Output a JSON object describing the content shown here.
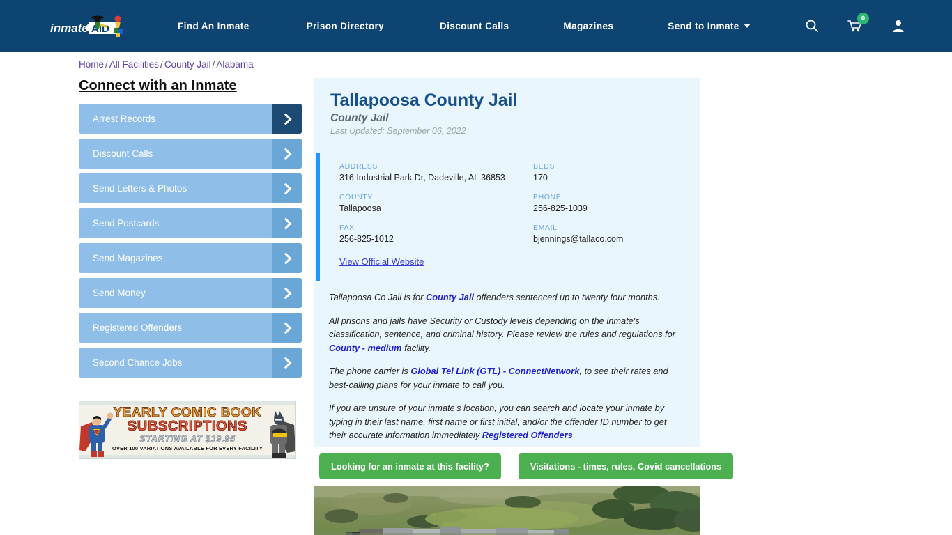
{
  "header": {
    "logo_text": "inmateAID",
    "logo_icon": "inmate-aid-logo",
    "nav_items": [
      {
        "label": "Find An Inmate"
      },
      {
        "label": "Prison Directory"
      },
      {
        "label": "Discount Calls"
      },
      {
        "label": "Magazines"
      },
      {
        "label": "Send to Inmate"
      }
    ],
    "icons": {
      "search": "search-icon",
      "cart": "cart-icon",
      "cart_badge_count": "0",
      "account": "user-account-icon"
    },
    "colors": {
      "nav_bg": "#0e4472",
      "badge": "#2bb673"
    }
  },
  "breadcrumb": {
    "items": [
      {
        "label": "Home"
      },
      {
        "label": "All Facilities"
      },
      {
        "label": "County Jail"
      },
      {
        "label": "Alabama"
      }
    ],
    "separator": "/"
  },
  "sidebar": {
    "title": "Connect with an Inmate",
    "items": [
      {
        "label": "Arrest Records",
        "active": true
      },
      {
        "label": "Discount Calls",
        "active": false
      },
      {
        "label": "Send Letters & Photos",
        "active": false
      },
      {
        "label": "Send Postcards",
        "active": false
      },
      {
        "label": "Send Magazines",
        "active": false
      },
      {
        "label": "Send Money",
        "active": false
      },
      {
        "label": "Registered Offenders",
        "active": false
      },
      {
        "label": "Second Chance Jobs",
        "active": false
      }
    ],
    "ad": {
      "line1": "YEARLY COMIC BOOK",
      "line2": "SUBSCRIPTIONS",
      "line3": "STARTING AT $19.95",
      "line4": "OVER 100 VARIATIONS AVAILABLE FOR EVERY FACILITY"
    }
  },
  "facility": {
    "name": "Tallapoosa County Jail",
    "type": "County Jail",
    "last_updated": "Last Updated: September 06, 2022",
    "details": {
      "address_label": "ADDRESS",
      "address_value": "316 Industrial Park Dr, Dadeville, AL 36853",
      "beds_label": "BEDS",
      "beds_value": "170",
      "county_label": "COUNTY",
      "county_value": "Tallapoosa",
      "phone_label": "PHONE",
      "phone_value": "256-825-1039",
      "fax_label": "FAX",
      "fax_value": "256-825-1012",
      "email_label": "EMAIL",
      "email_value": "bjennings@tallaco.com"
    },
    "official_website_label": "View Official Website"
  },
  "description": {
    "p1_a": "Tallapoosa Co Jail is for ",
    "p1_link": "County Jail",
    "p1_b": " offenders sentenced up to twenty four months.",
    "p2_a": "All prisons and jails have Security or Custody levels depending on the inmate's classification, sentence, and criminal history. Please review the rules and regulations for ",
    "p2_link": "County - medium",
    "p2_b": " facility.",
    "p3_a": "The phone carrier is ",
    "p3_link": "Global Tel Link (GTL) - ConnectNetwork",
    "p3_b": ", to see their rates and best-calling plans for your inmate to call you.",
    "p4_a": "If you are unsure of your inmate's location, you can search and locate your inmate by typing in their last name, first name or first initial, and/or the offender ID number to get their accurate information immediately ",
    "p4_link": "Registered Offenders"
  },
  "actions": {
    "inmate_search_label": "Looking for an inmate at this facility?",
    "visitations_label": "Visitations - times, rules, Covid cancellations",
    "button_color": "#4caf50"
  },
  "media": {
    "aerial_alt": "aerial-satellite-view-of-facility"
  }
}
